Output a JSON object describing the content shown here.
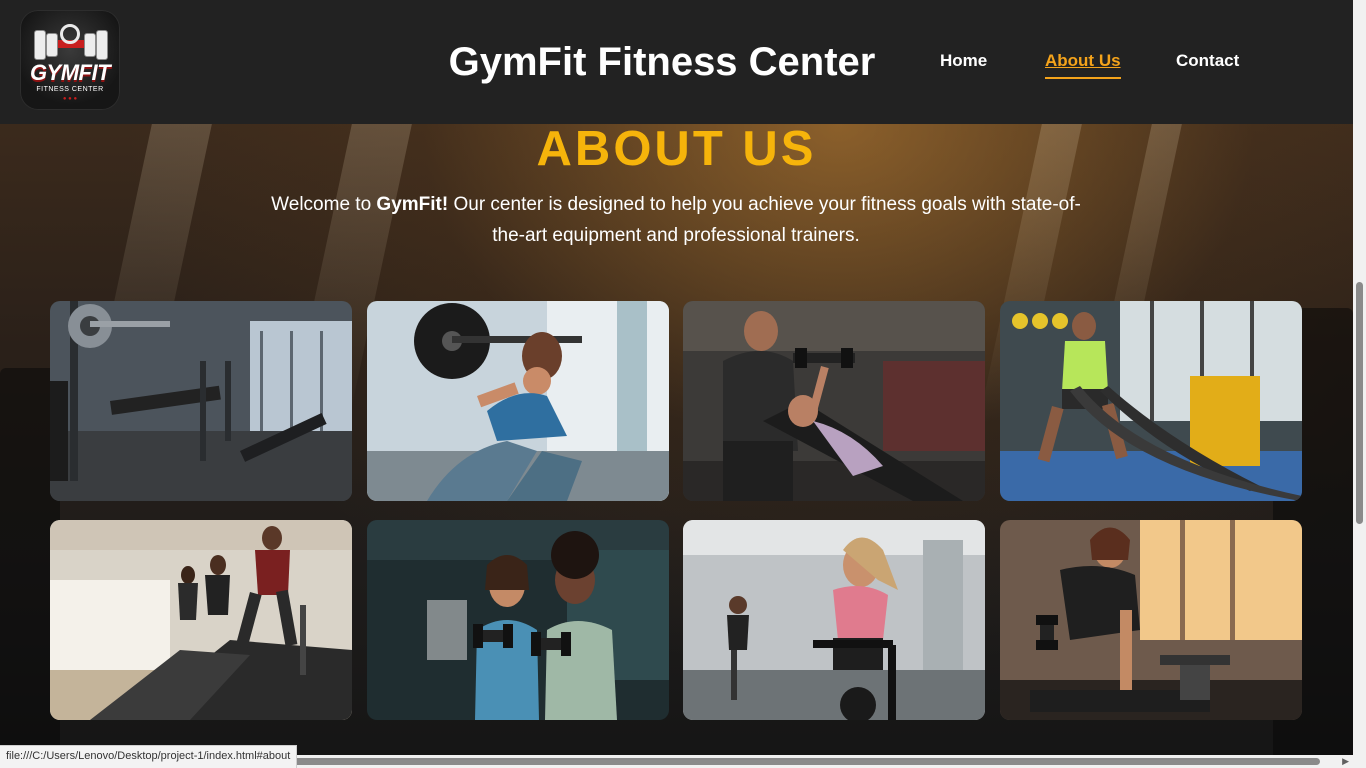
{
  "header": {
    "logo": {
      "wordmark": "GYMFIT",
      "tagline": "FITNESS CENTER"
    },
    "site_title": "GymFit Fitness Center",
    "nav": [
      {
        "label": "Home",
        "active": false
      },
      {
        "label": "About Us",
        "active": true
      },
      {
        "label": "Contact",
        "active": false
      }
    ]
  },
  "about": {
    "title": "ABOUT US",
    "text_intro": "Welcome to ",
    "text_brand": "GymFit!",
    "text_body": " Our center is designed to help you achieve your fitness goals with state-of-the-art equipment and professional trainers."
  },
  "gallery": [
    {
      "name": "gallery-photo-empty-gym-machines"
    },
    {
      "name": "gallery-photo-woman-barbell-squat"
    },
    {
      "name": "gallery-photo-trainer-dumbbell-press"
    },
    {
      "name": "gallery-photo-man-battle-ropes"
    },
    {
      "name": "gallery-photo-treadmill-runners"
    },
    {
      "name": "gallery-photo-two-women-dumbbells"
    },
    {
      "name": "gallery-photo-spin-class"
    },
    {
      "name": "gallery-photo-woman-dumbbell-row"
    }
  ],
  "status_bar": {
    "url": "file:///C:/Users/Lenovo/Desktop/project-1/index.html#about"
  },
  "colors": {
    "accent": "#f6b40b",
    "nav_active": "#f4a31b",
    "header_bg": "#222222"
  }
}
